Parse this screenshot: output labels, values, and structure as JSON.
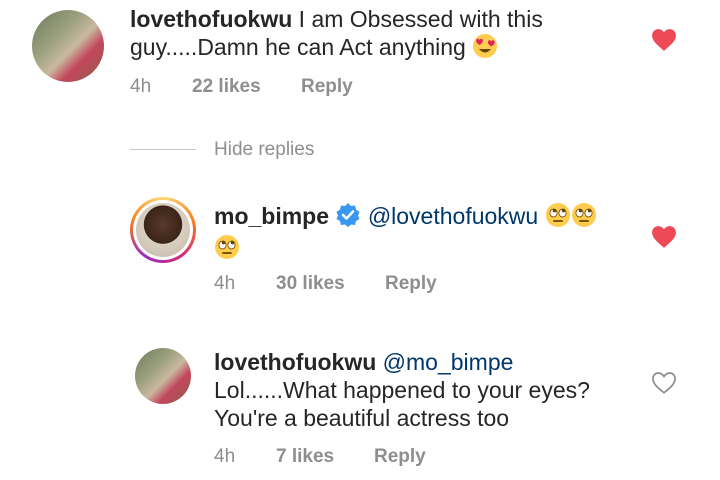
{
  "comment": {
    "username": "lovethofuokwu",
    "text_line1": "I am Obsessed with this",
    "text_line2": "guy.....Damn he can Act anything",
    "time": "4h",
    "likes": "22 likes",
    "reply_label": "Reply",
    "liked": true
  },
  "hide_replies_label": "Hide replies",
  "replies": [
    {
      "username": "mo_bimpe",
      "verified": true,
      "mention": "@lovethofuokwu",
      "time": "4h",
      "likes": "30 likes",
      "reply_label": "Reply",
      "liked": true
    },
    {
      "username": "lovethofuokwu",
      "mention": "@mo_bimpe",
      "text_line1": "Lol......What happened to your eyes?",
      "text_line2": "You're a beautiful actress too",
      "time": "4h",
      "likes": "7 likes",
      "reply_label": "Reply",
      "liked": false
    }
  ],
  "colors": {
    "heart_liked": "#ed4956",
    "heart_outline": "#8e8e8e",
    "verified": "#3897f0",
    "mention": "#00376b",
    "meta": "#8e8e8e"
  }
}
